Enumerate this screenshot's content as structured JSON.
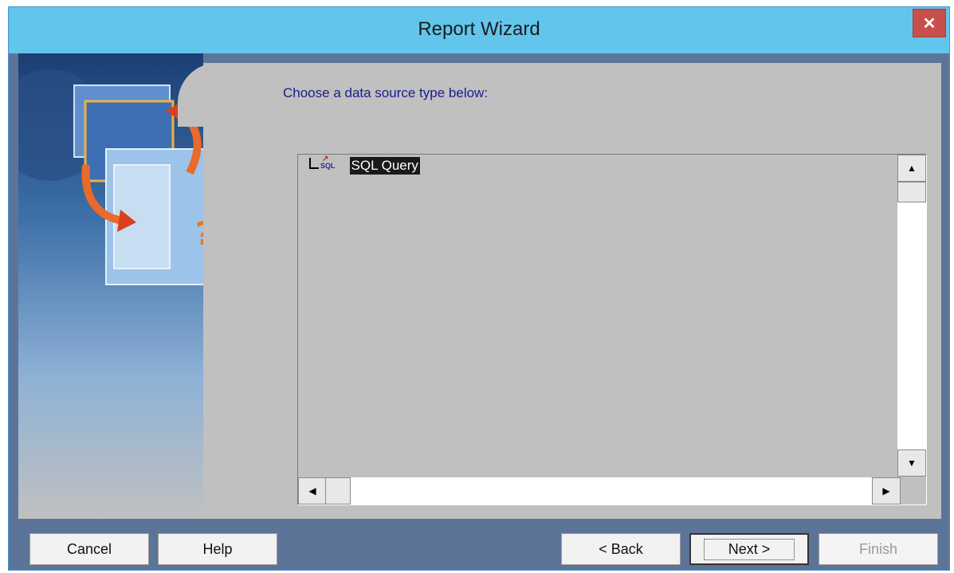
{
  "window": {
    "title": "Report Wizard",
    "close_glyph": "✕"
  },
  "prompt": "Choose a data source type below:",
  "list": {
    "items": [
      {
        "icon": "sql-query-icon",
        "icon_text": "SQL",
        "label": "SQL Query",
        "selected": true
      }
    ]
  },
  "scrollbars": {
    "up": "▲",
    "down": "▼",
    "left": "◀",
    "right": "▶"
  },
  "buttons": {
    "cancel": "Cancel",
    "help": "Help",
    "back": "< Back",
    "next": "Next >",
    "finish": "Finish"
  },
  "colors": {
    "titlebar": "#62c6ec",
    "content_bg": "#c0c0c0",
    "frame": "#5d7499",
    "close": "#c7504a",
    "prompt_text": "#1c1c8c"
  }
}
